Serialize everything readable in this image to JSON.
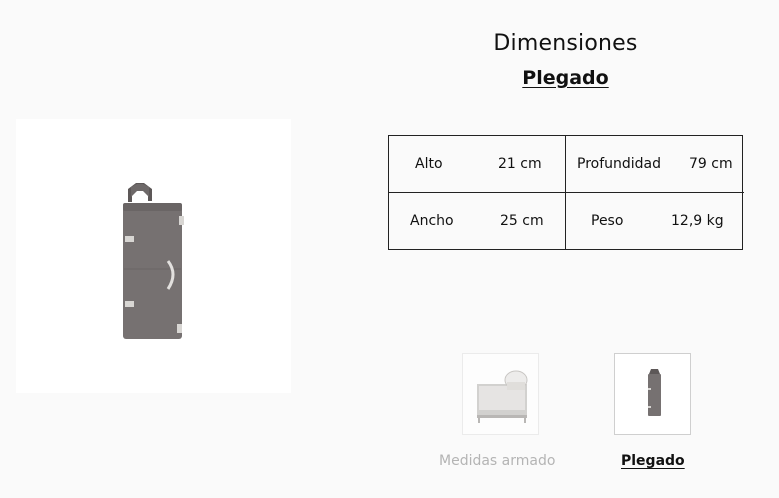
{
  "section": {
    "title": "Dimensiones",
    "subtitle": "Plegado"
  },
  "dimensions": [
    {
      "label": "Alto",
      "value": "21 cm"
    },
    {
      "label": "Profundidad",
      "value": "79 cm"
    },
    {
      "label": "Ancho",
      "value": "25 cm"
    },
    {
      "label": "Peso",
      "value": "12,9 kg"
    }
  ],
  "thumbnails": [
    {
      "label": "Medidas armado",
      "selected": false
    },
    {
      "label": "Plegado",
      "selected": true
    }
  ],
  "colors": {
    "product_gray": "#767171",
    "border": "#222222",
    "inactive_text": "#b4b4b4"
  }
}
